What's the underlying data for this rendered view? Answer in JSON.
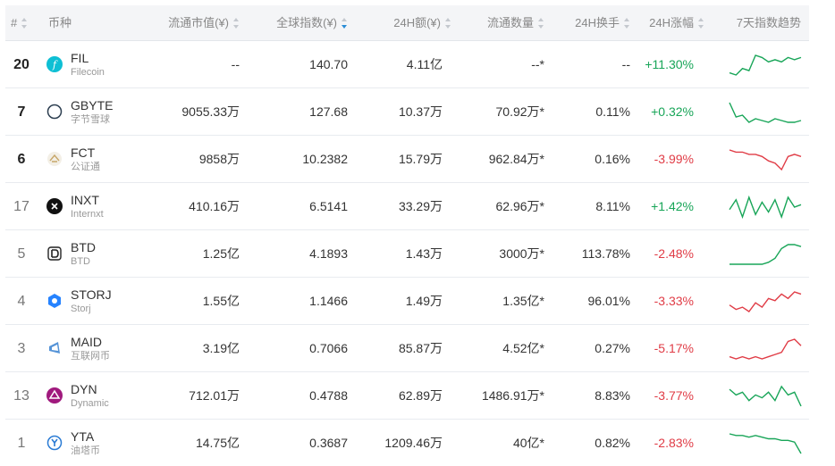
{
  "header": {
    "rank": "#",
    "coin": "币种",
    "market_cap": "流通市值(¥)",
    "global_index": "全球指数(¥)",
    "volume_24h": "24H额(¥)",
    "circulating": "流通数量",
    "turnover_24h": "24H换手",
    "change_24h": "24H涨幅",
    "trend_7d": "7天指数趋势"
  },
  "colors": {
    "up": "#18a558",
    "down": "#e03c46",
    "sort_active": "#2a8cd6"
  },
  "rows": [
    {
      "rank": "20",
      "symbol": "FIL",
      "name": "Filecoin",
      "icon": "filecoin-icon",
      "market_cap": "--",
      "index": "140.70",
      "volume": "4.11亿",
      "circulating": "--*",
      "turnover": "--",
      "change": "+11.30%",
      "direction": "up",
      "trend": [
        10,
        9,
        12,
        11,
        18,
        17,
        15,
        16,
        15,
        17,
        16,
        17
      ]
    },
    {
      "rank": "7",
      "symbol": "GBYTE",
      "name": "字节雪球",
      "icon": "byteball-icon",
      "market_cap": "9055.33万",
      "index": "127.68",
      "volume": "10.37万",
      "circulating": "70.92万*",
      "turnover": "0.11%",
      "change": "+0.32%",
      "direction": "up",
      "trend": [
        20,
        12,
        13,
        9,
        11,
        10,
        9,
        11,
        10,
        9,
        9,
        10
      ]
    },
    {
      "rank": "6",
      "symbol": "FCT",
      "name": "公证通",
      "icon": "factom-icon",
      "market_cap": "9858万",
      "index": "10.2382",
      "volume": "15.79万",
      "circulating": "962.84万*",
      "turnover": "0.16%",
      "change": "-3.99%",
      "direction": "down",
      "trend": [
        18,
        17,
        17,
        16,
        16,
        15,
        13,
        12,
        9,
        15,
        16,
        15
      ]
    },
    {
      "rank": "17",
      "symbol": "INXT",
      "name": "Internxt",
      "icon": "internxt-icon",
      "market_cap": "410.16万",
      "index": "6.5141",
      "volume": "33.29万",
      "circulating": "62.96万*",
      "turnover": "8.11%",
      "change": "+1.42%",
      "direction": "up",
      "trend": [
        14,
        18,
        11,
        19,
        12,
        17,
        13,
        18,
        11,
        19,
        15,
        16
      ]
    },
    {
      "rank": "5",
      "symbol": "BTD",
      "name": "BTD",
      "icon": "btd-icon",
      "market_cap": "1.25亿",
      "index": "4.1893",
      "volume": "1.43万",
      "circulating": "3000万*",
      "turnover": "113.78%",
      "change": "-2.48%",
      "direction": "up",
      "trend": [
        8,
        8,
        8,
        8,
        8,
        8,
        9,
        11,
        16,
        18,
        18,
        17
      ]
    },
    {
      "rank": "4",
      "symbol": "STORJ",
      "name": "Storj",
      "icon": "storj-icon",
      "market_cap": "1.55亿",
      "index": "1.1466",
      "volume": "1.49万",
      "circulating": "1.35亿*",
      "turnover": "96.01%",
      "change": "-3.33%",
      "direction": "down",
      "trend": [
        10,
        8,
        9,
        7,
        11,
        9,
        13,
        12,
        15,
        13,
        16,
        15
      ]
    },
    {
      "rank": "3",
      "symbol": "MAID",
      "name": "互联网币",
      "icon": "maidsafe-icon",
      "market_cap": "3.19亿",
      "index": "0.7066",
      "volume": "85.87万",
      "circulating": "4.52亿*",
      "turnover": "0.27%",
      "change": "-5.17%",
      "direction": "down",
      "trend": [
        8,
        7,
        8,
        7,
        8,
        7,
        8,
        9,
        10,
        15,
        16,
        13
      ]
    },
    {
      "rank": "13",
      "symbol": "DYN",
      "name": "Dynamic",
      "icon": "dynamic-icon",
      "market_cap": "712.01万",
      "index": "0.4788",
      "volume": "62.89万",
      "circulating": "1486.91万*",
      "turnover": "8.83%",
      "change": "-3.77%",
      "direction": "up",
      "trend": [
        14,
        12,
        13,
        10,
        12,
        11,
        13,
        10,
        15,
        12,
        13,
        8
      ]
    },
    {
      "rank": "1",
      "symbol": "YTA",
      "name": "油塔币",
      "icon": "yottachain-icon",
      "market_cap": "14.75亿",
      "index": "0.3687",
      "volume": "1209.46万",
      "circulating": "40亿*",
      "turnover": "0.82%",
      "change": "-2.83%",
      "direction": "up",
      "trend": [
        18,
        17,
        17,
        16,
        17,
        16,
        15,
        15,
        14,
        14,
        13,
        6
      ]
    }
  ]
}
